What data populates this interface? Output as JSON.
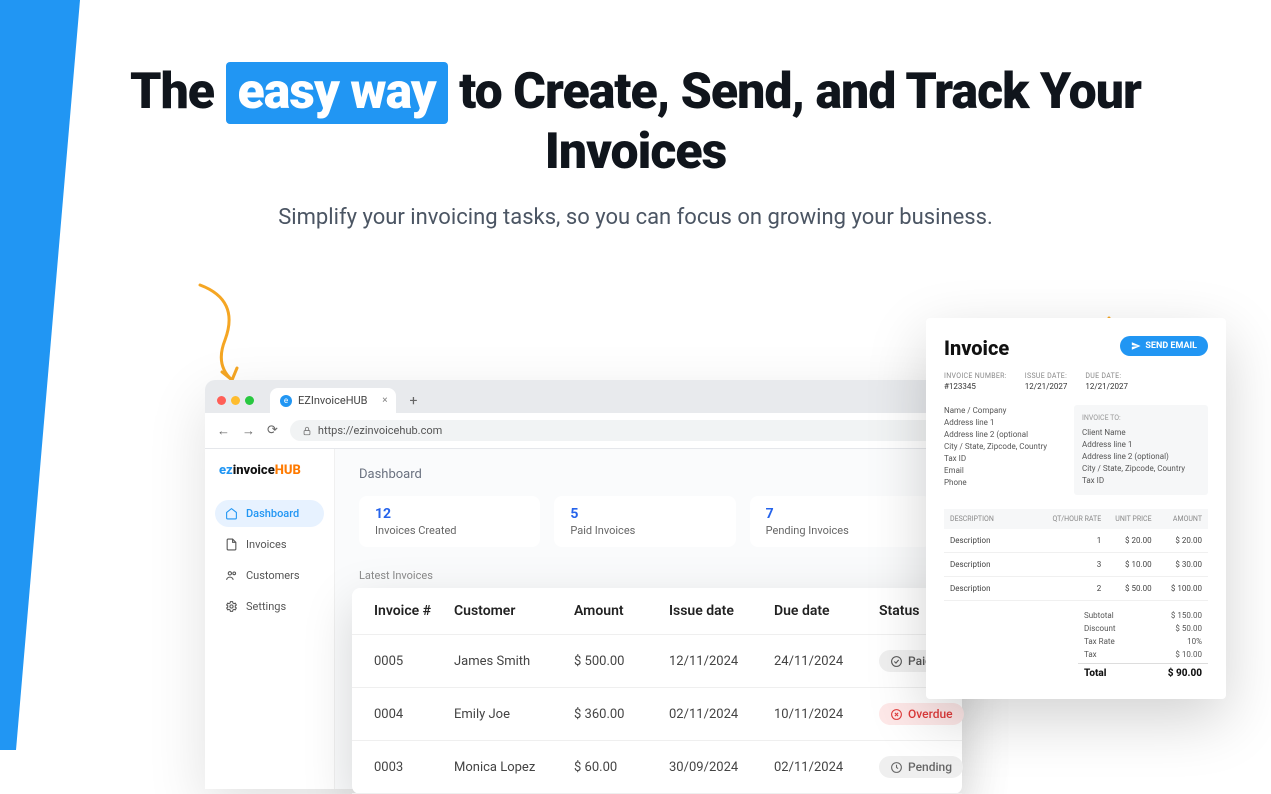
{
  "hero": {
    "title_pre": "The ",
    "title_hl": "easy way",
    "title_post": " to Create, Send, and Track Your Invoices",
    "subtitle": "Simplify your invoicing tasks, so you can focus on growing your business."
  },
  "browser": {
    "tab_title": "EZInvoiceHUB",
    "url": "https://ezinvoicehub.com"
  },
  "logo": {
    "ez": "ez",
    "invoice": "invoice",
    "hub": "HUB"
  },
  "sidebar": {
    "items": [
      {
        "label": "Dashboard"
      },
      {
        "label": "Invoices"
      },
      {
        "label": "Customers"
      },
      {
        "label": "Settings"
      }
    ]
  },
  "dashboard": {
    "title": "Dashboard",
    "stats": [
      {
        "n": "12",
        "l": "Invoices Created"
      },
      {
        "n": "5",
        "l": "Paid Invoices"
      },
      {
        "n": "7",
        "l": "Pending Invoices"
      }
    ],
    "latest_title": "Latest Invoices"
  },
  "table": {
    "headers": {
      "c0": "Invoice #",
      "c1": "Customer",
      "c2": "Amount",
      "c3": "Issue date",
      "c4": "Due date",
      "c5": "Status"
    },
    "rows": [
      {
        "num": "0005",
        "cust": "James Smith",
        "amt": "$ 500.00",
        "issue": "12/11/2024",
        "due": "24/11/2024",
        "status": "Paid",
        "kind": "paid"
      },
      {
        "num": "0004",
        "cust": "Emily Joe",
        "amt": "$ 360.00",
        "issue": "02/11/2024",
        "due": "10/11/2024",
        "status": "Overdue",
        "kind": "overdue"
      },
      {
        "num": "0003",
        "cust": "Monica Lopez",
        "amt": "$ 60.00",
        "issue": "30/09/2024",
        "due": "02/11/2024",
        "status": "Pending",
        "kind": "pending"
      }
    ]
  },
  "invoice": {
    "title": "Invoice",
    "send_btn": "SEND EMAIL",
    "meta": {
      "number_l": "INVOICE NUMBER:",
      "number_v": "#123345",
      "issue_l": "ISSUE DATE:",
      "issue_v": "12/21/2027",
      "due_l": "DUE DATE:",
      "due_v": "12/21/2027"
    },
    "from": [
      "Name / Company",
      "Address line 1",
      "Address line 2 (optional",
      "City / State, Zipcode, Country",
      "Tax ID",
      "Email",
      "Phone"
    ],
    "to_label": "INVOICE TO:",
    "to": [
      "Client Name",
      "Address line 1",
      "Address line 2 (optional)",
      "City / State, Zipcode, Country",
      "Tax ID"
    ],
    "cols": {
      "c0": "DESCRIPTION",
      "c1": "QT/HOUR RATE",
      "c2": "UNIT PRICE",
      "c3": "AMOUNT"
    },
    "items": [
      {
        "d": "Description",
        "q": "1",
        "p": "$ 20.00",
        "a": "$ 20.00"
      },
      {
        "d": "Description",
        "q": "3",
        "p": "$ 10.00",
        "a": "$ 30.00"
      },
      {
        "d": "Description",
        "q": "2",
        "p": "$ 50.00",
        "a": "$ 100.00"
      }
    ],
    "totals": [
      {
        "l": "Subtotal",
        "v": "$ 150.00"
      },
      {
        "l": "Discount",
        "v": "$ 50.00"
      },
      {
        "l": "Tax Rate",
        "v": "10%"
      },
      {
        "l": "Tax",
        "v": "$ 10.00"
      }
    ],
    "grand": {
      "l": "Total",
      "v": "$ 90.00"
    }
  }
}
